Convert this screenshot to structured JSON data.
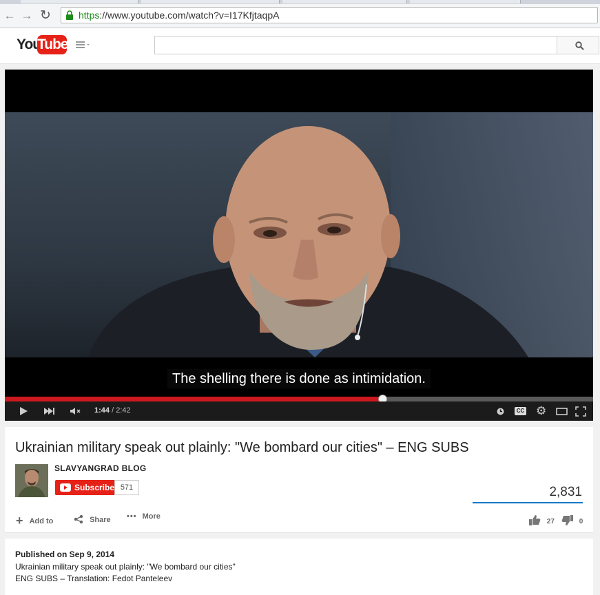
{
  "browser": {
    "url_scheme": "https",
    "url_rest": "://www.youtube.com/watch?v=I17KfjtaqpA",
    "back_icon": "arrow-left-icon",
    "forward_icon": "arrow-right-icon",
    "reload_icon": "reload-icon",
    "lock_icon": "padlock-icon"
  },
  "youtube": {
    "logo_you": "You",
    "logo_tube": "Tube",
    "search_placeholder": ""
  },
  "player": {
    "subtitle": "The shelling there is done as intimidation.",
    "current_time": "1:44",
    "duration": "/ 2:42",
    "progress_fraction": 0.642,
    "icons": [
      "play-icon",
      "next-icon",
      "mute-icon",
      "watch-later-icon",
      "cc-icon",
      "settings-icon",
      "theater-icon",
      "fullscreen-icon"
    ],
    "cc_label": "CC"
  },
  "video": {
    "title": "Ukrainian military speak out plainly: \"We bombard our cities\" – ENG SUBS",
    "channel": "SLAVYANGRAD BLOG",
    "subscribe_label": "Subscribe",
    "subscriber_count": "571",
    "views": "2,831",
    "actions": {
      "add_to": "Add to",
      "share": "Share",
      "more": "More"
    },
    "likes": "27",
    "dislikes": "0"
  },
  "description": {
    "published": "Published on Sep 9, 2014",
    "line1": "Ukrainian military speak out plainly: \"We bombard our cities\"",
    "line2": "ENG SUBS – Translation: Fedot Panteleev"
  },
  "colors": {
    "youtube_red": "#e62117",
    "progress_red": "#cc181e",
    "view_bar_blue": "#167ac6"
  }
}
